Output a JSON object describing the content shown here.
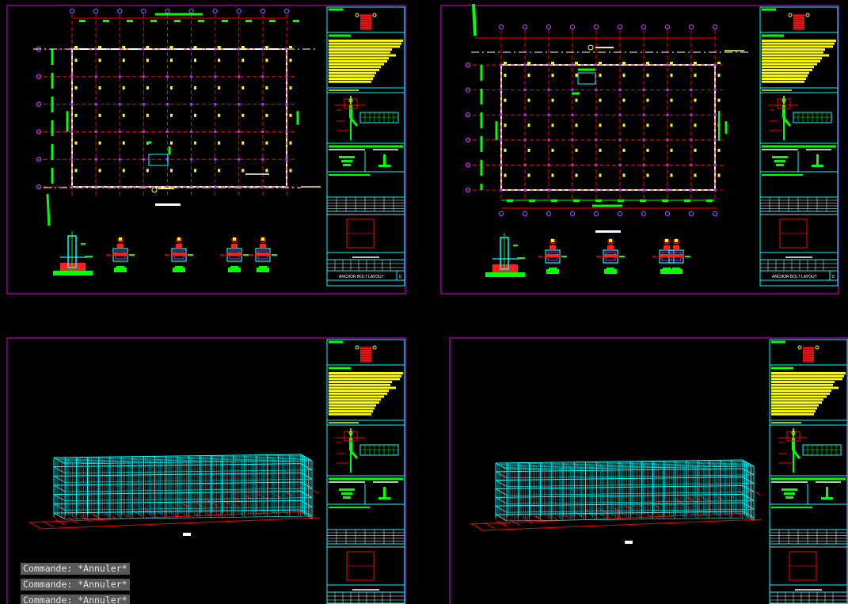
{
  "app": "AutoCAD",
  "colors": {
    "background": "#000000",
    "sheet_border": "#c000c0",
    "grid": "#ff0000",
    "column": "#ffffff",
    "bolt": "#ffff00",
    "node": "#a040ff",
    "dim": "#00ff00",
    "frame3d": "#00ffff",
    "titleblock": "#00ffff",
    "fill": "#ffff00"
  },
  "sheets": [
    {
      "id": "tl",
      "title": "ANCHOR BOLT LAYOUT",
      "rev": "0"
    },
    {
      "id": "tr",
      "title": "ANCHOR BOLT LAYOUT",
      "rev": "0"
    },
    {
      "id": "bl",
      "title": "",
      "rev": ""
    },
    {
      "id": "br",
      "title": "",
      "rev": ""
    }
  ],
  "command_line": [
    "Commande: *Annuler*",
    "Commande: *Annuler*",
    "Commande: *Annuler*"
  ]
}
